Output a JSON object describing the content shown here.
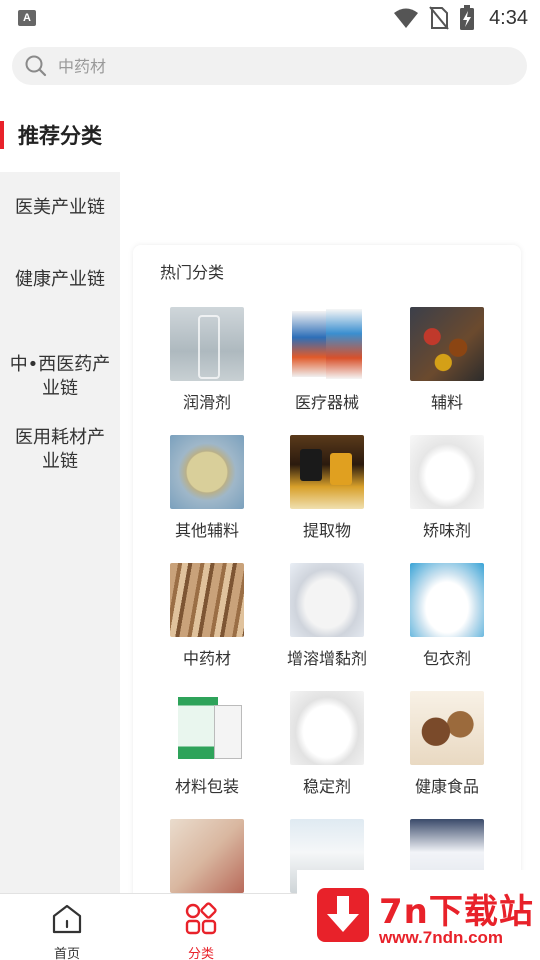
{
  "status_bar": {
    "app_icon_letter": "A",
    "time": "4:34",
    "icons": [
      "wifi-icon",
      "no-sim-icon",
      "battery-charging-icon"
    ]
  },
  "search": {
    "placeholder": "中药材",
    "icon": "search-icon"
  },
  "section": {
    "title": "推荐分类",
    "accent_color": "#e8222a"
  },
  "sidebar": {
    "items": [
      {
        "label": "医美产业链"
      },
      {
        "label": "健康产业链"
      },
      {
        "label": "中•西医药产\n业链"
      },
      {
        "label": "医用耗材产\n业链"
      }
    ]
  },
  "card": {
    "title": "热门分类",
    "items": [
      {
        "label": "润滑剂"
      },
      {
        "label": "医疗器械"
      },
      {
        "label": "辅料"
      },
      {
        "label": "其他辅料"
      },
      {
        "label": "提取物"
      },
      {
        "label": "矫味剂"
      },
      {
        "label": "中药材"
      },
      {
        "label": "增溶增黏剂"
      },
      {
        "label": "包衣剂"
      },
      {
        "label": "材料包装"
      },
      {
        "label": "稳定剂"
      },
      {
        "label": "健康食品"
      },
      {
        "label": ""
      },
      {
        "label": ""
      },
      {
        "label": ""
      }
    ]
  },
  "bottom_nav": {
    "items": [
      {
        "label": "首页",
        "icon": "home-icon",
        "active": false
      },
      {
        "label": "分类",
        "icon": "category-grid-icon",
        "active": true
      }
    ],
    "active_color": "#e8222a"
  },
  "watermark": {
    "title": "7n下载站",
    "url": "www.7ndn.com",
    "icon": "download-arrow-icon",
    "color": "#e8222a"
  }
}
